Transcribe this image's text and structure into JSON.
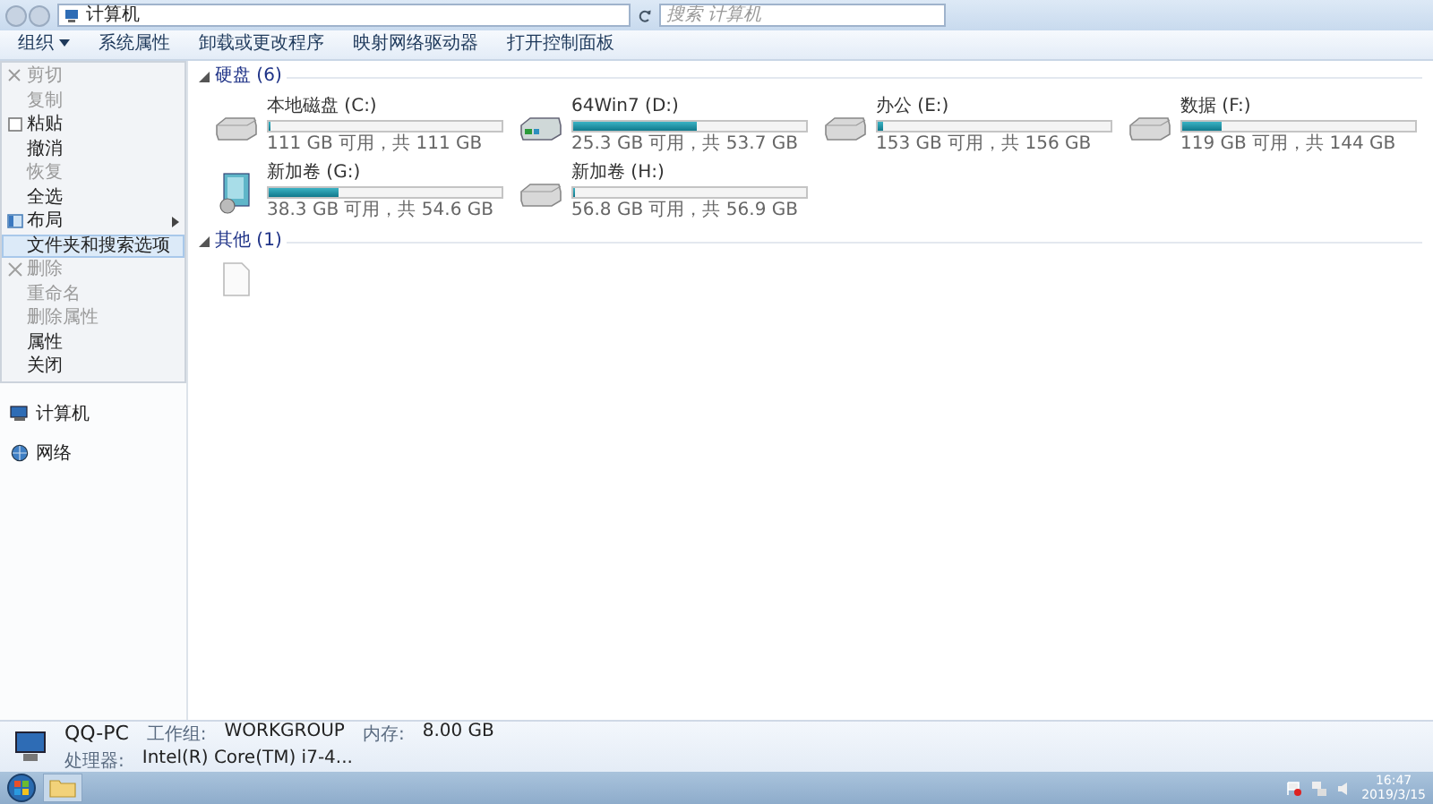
{
  "address": {
    "path": "计算机",
    "search_placeholder": "搜索 计算机"
  },
  "toolbar": [
    {
      "label": "组织",
      "dropdown": true
    },
    {
      "label": "系统属性",
      "dropdown": false
    },
    {
      "label": "卸载或更改程序",
      "dropdown": false
    },
    {
      "label": "映射网络驱动器",
      "dropdown": false
    },
    {
      "label": "打开控制面板",
      "dropdown": false
    }
  ],
  "menu": [
    {
      "label": "剪切",
      "kind": "cut",
      "disabled": true,
      "selected": false,
      "submenu": false
    },
    {
      "label": "复制",
      "kind": "plain",
      "disabled": true,
      "selected": false,
      "submenu": false
    },
    {
      "label": "粘贴",
      "kind": "paste",
      "disabled": false,
      "selected": false,
      "submenu": false
    },
    {
      "label": "撤消",
      "kind": "plain",
      "disabled": false,
      "selected": false,
      "submenu": false
    },
    {
      "label": "恢复",
      "kind": "plain",
      "disabled": true,
      "selected": false,
      "submenu": false
    },
    {
      "label": "全选",
      "kind": "plain",
      "disabled": false,
      "selected": false,
      "submenu": false
    },
    {
      "label": "布局",
      "kind": "layout",
      "disabled": false,
      "selected": false,
      "submenu": true
    },
    {
      "label": "文件夹和搜索选项",
      "kind": "plain",
      "disabled": false,
      "selected": true,
      "submenu": false
    },
    {
      "label": "删除",
      "kind": "delete",
      "disabled": true,
      "selected": false,
      "submenu": false
    },
    {
      "label": "重命名",
      "kind": "plain",
      "disabled": true,
      "selected": false,
      "submenu": false
    },
    {
      "label": "删除属性",
      "kind": "plain",
      "disabled": true,
      "selected": false,
      "submenu": false
    },
    {
      "label": "属性",
      "kind": "plain",
      "disabled": false,
      "selected": false,
      "submenu": false
    },
    {
      "label": "关闭",
      "kind": "plain",
      "disabled": false,
      "selected": false,
      "submenu": false
    }
  ],
  "nav": [
    {
      "label": "计算机",
      "kind": "computer"
    },
    {
      "label": "网络",
      "kind": "network"
    }
  ],
  "groups": [
    {
      "title": "硬盘 (6)",
      "expanded": true,
      "items": [
        {
          "kind": "disk",
          "name": "本地磁盘 (C:)",
          "level": 0.01,
          "space": "111 GB 可用，共 111 GB"
        },
        {
          "kind": "system",
          "name": "64Win7 (D:)",
          "level": 0.53,
          "space": "25.3 GB 可用，共 53.7 GB"
        },
        {
          "kind": "disk",
          "name": "办公 (E:)",
          "level": 0.02,
          "space": "153 GB 可用，共 156 GB"
        },
        {
          "kind": "disk",
          "name": "数据 (F:)",
          "level": 0.17,
          "space": "119 GB 可用，共 144 GB"
        },
        {
          "kind": "package",
          "name": "新加卷 (G:)",
          "level": 0.3,
          "space": "38.3 GB 可用，共 54.6 GB"
        },
        {
          "kind": "disk",
          "name": "新加卷 (H:)",
          "level": 0.01,
          "space": "56.8 GB 可用，共 56.9 GB"
        }
      ]
    },
    {
      "title": "其他 (1)",
      "expanded": true,
      "items": [
        {
          "kind": "file"
        }
      ]
    }
  ],
  "details": {
    "computer_name": "QQ-PC",
    "workgroup_label": "工作组:",
    "workgroup": "WORKGROUP",
    "memory_label": "内存:",
    "memory": "8.00 GB",
    "cpu_label": "处理器:",
    "cpu": "Intel(R) Core(TM) i7-4..."
  },
  "taskbar": {
    "time": "16:47",
    "date": "2019/3/15"
  }
}
